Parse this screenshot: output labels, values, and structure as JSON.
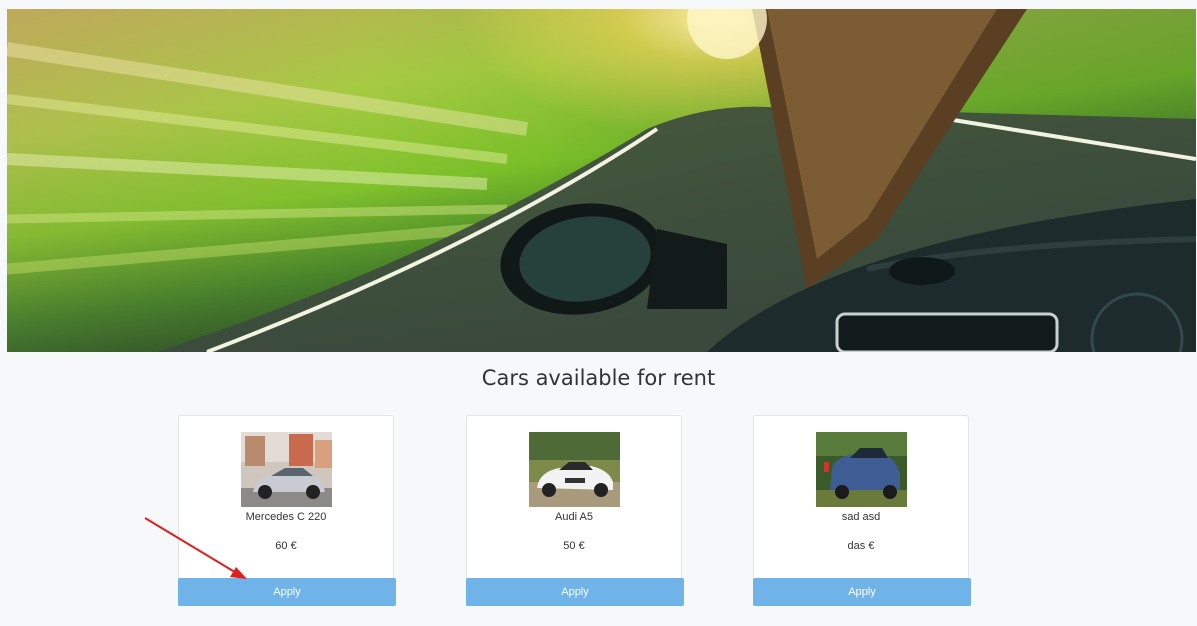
{
  "heading": "Cars available for rent",
  "cars": [
    {
      "name": "Mercedes C 220",
      "price": "60 €",
      "apply_label": "Apply"
    },
    {
      "name": "Audi A5",
      "price": "50 €",
      "apply_label": "Apply"
    },
    {
      "name": "sad asd",
      "price": "das €",
      "apply_label": "Apply"
    }
  ],
  "colors": {
    "button": "#6fb3e8",
    "annotation_arrow": "#e02020",
    "page_bg": "#f6f8fa"
  }
}
